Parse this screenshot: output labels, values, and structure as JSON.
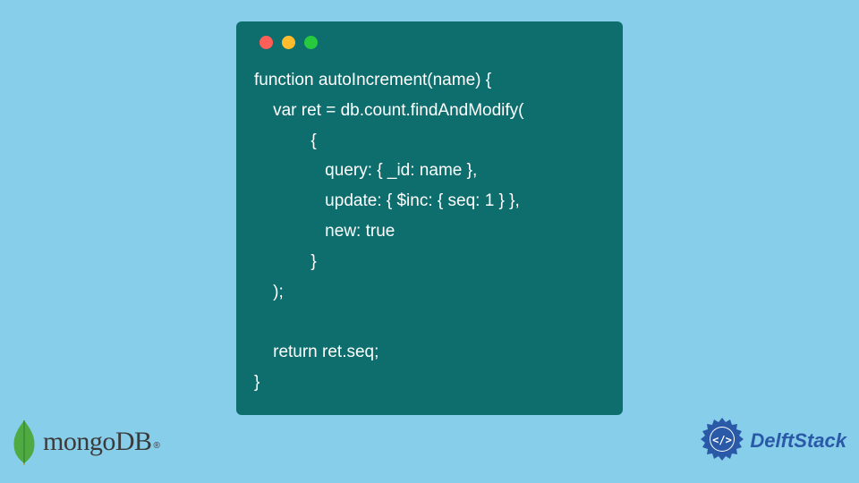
{
  "code": {
    "lines": [
      "function autoIncrement(name) {",
      "    var ret = db.count.findAndModify(",
      "            {",
      "               query: { _id: name },",
      "               update: { $inc: { seq: 1 } },",
      "               new: true",
      "            }",
      "    );",
      "",
      "    return ret.seq;",
      "}"
    ]
  },
  "traffic": {
    "red_name": "traffic-dot-red",
    "yellow_name": "traffic-dot-yellow",
    "green_name": "traffic-dot-green"
  },
  "logos": {
    "mongo": {
      "text": "mongoDB",
      "reg": "®"
    },
    "delft": {
      "text": "DelftStack"
    }
  },
  "colors": {
    "page_bg": "#87ceeb",
    "code_bg": "#0e6e6e",
    "code_fg": "#ffffff",
    "mongo_leaf": "#4faa41",
    "delft_accent": "#2a5aa7"
  }
}
